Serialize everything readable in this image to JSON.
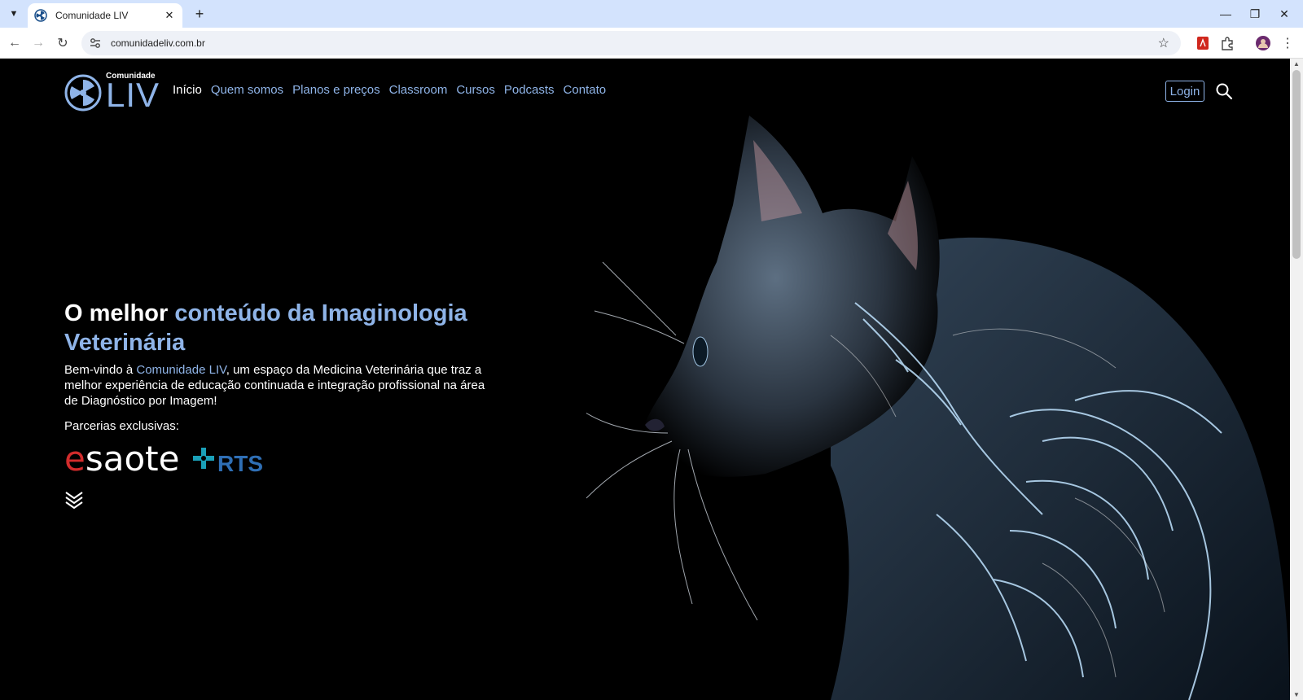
{
  "browser": {
    "tab_title": "Comunidade LIV",
    "url": "comunidadeliv.com.br"
  },
  "site": {
    "logo_small": "Comunidade",
    "logo_big": "LIV",
    "nav": [
      {
        "label": "Início",
        "active": true
      },
      {
        "label": "Quem somos"
      },
      {
        "label": "Planos e preços"
      },
      {
        "label": "Classroom"
      },
      {
        "label": "Cursos"
      },
      {
        "label": "Podcasts"
      },
      {
        "label": "Contato"
      }
    ],
    "login_label": "Login"
  },
  "hero": {
    "headline_plain": "O melhor ",
    "headline_accent": "conteúdo da Imaginologia Veterinária",
    "intro_before": "Bem-vindo à ",
    "intro_accent": "Comunidade LIV",
    "intro_after": ", um espaço da Medicina Veterinária que traz a melhor experiência de educação continuada e integração profissional na área de Diagnóstico por Imagem!",
    "partners_label": "Parcerias exclusivas:",
    "partner_esaote_e": "e",
    "partner_esaote_rest": "saote",
    "partner_rts": "RTS"
  },
  "colors": {
    "accent": "#8fb4e8",
    "background": "#000000",
    "esaote_red": "#d22c2c",
    "rts_blue": "#2f6fb5",
    "rts_teal": "#1aa0b8"
  }
}
